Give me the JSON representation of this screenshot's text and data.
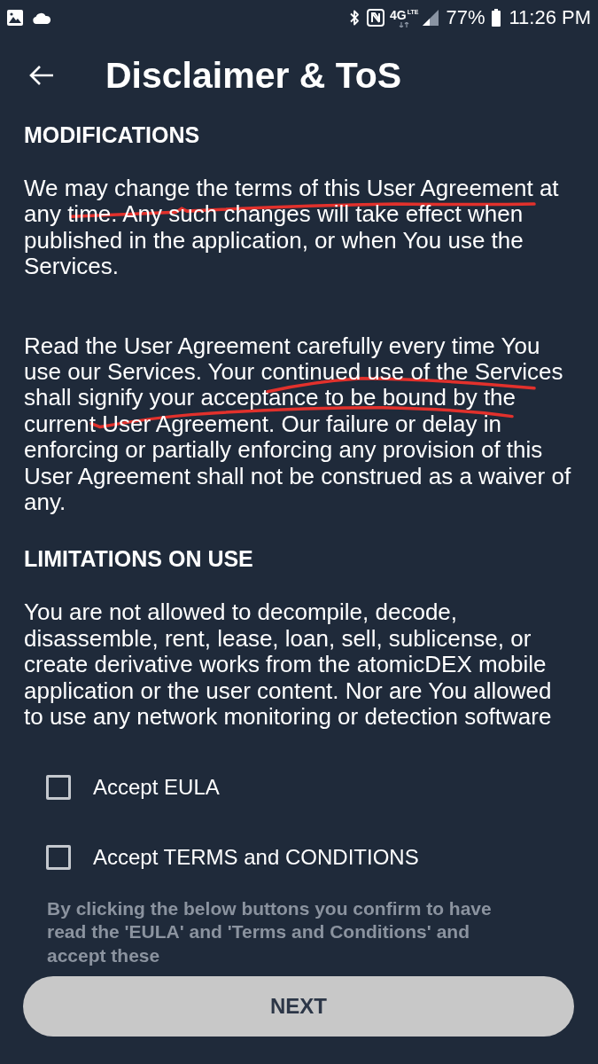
{
  "status_bar": {
    "network_type": "4G",
    "network_sub": "LTE",
    "battery_percent": "77%",
    "time": "11:26 PM"
  },
  "header": {
    "title": "Disclaimer & ToS"
  },
  "sections": [
    {
      "heading": "MODIFICATIONS",
      "paragraphs": [
        "We may change the terms of this User Agreement at any time. Any such changes will take effect when published in the application, or when You use the Services.",
        "Read the User Agreement carefully every time You use our Services. Your continued use of the Services shall signify your acceptance to be bound by the current User Agreement. Our failure or delay in enforcing or partially enforcing any provision of this User Agreement shall not be construed as a waiver of any."
      ]
    },
    {
      "heading": "LIMITATIONS ON USE",
      "paragraphs": [
        "You are not allowed to decompile, decode, disassemble, rent, lease, loan, sell, sublicense, or create derivative works from the atomicDEX mobile application or the user content. Nor are You allowed to use any network monitoring or detection software"
      ]
    }
  ],
  "checkboxes": [
    {
      "label": "Accept EULA",
      "checked": false
    },
    {
      "label": "Accept TERMS and CONDITIONS",
      "checked": false
    }
  ],
  "notice": "By clicking the below buttons you confirm to have read the 'EULA' and 'Terms and Conditions' and accept these",
  "next_button": {
    "label": "NEXT",
    "disabled": true
  }
}
